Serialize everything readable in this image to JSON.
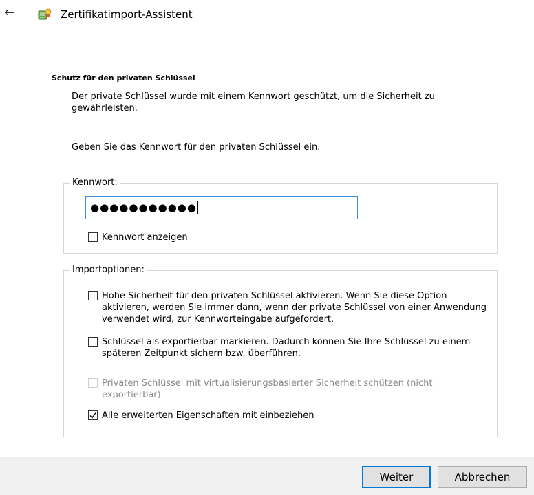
{
  "header": {
    "title": "Zertifikatimport-Assistent"
  },
  "section": {
    "title": "Schutz für den privaten Schlüssel",
    "description": "Der private Schlüssel wurde mit einem Kennwort geschützt, um die Sicherheit zu gewährleisten."
  },
  "instruction": "Geben Sie das Kennwort für den privaten Schlüssel ein.",
  "password_group": {
    "legend": "Kennwort:",
    "masked_value": "●●●●●●●●●●●",
    "show_password": {
      "label": "Kennwort anzeigen",
      "checked": false
    }
  },
  "import_options": {
    "legend": "Importoptionen:",
    "options": [
      {
        "label": "Hohe Sicherheit für den privaten Schlüssel aktivieren. Wenn Sie diese Option aktivieren, werden Sie immer dann, wenn der private Schlüssel von einer Anwendung verwendet wird, zur Kennworteingabe aufgefordert.",
        "checked": false,
        "enabled": true
      },
      {
        "label": "Schlüssel als exportierbar markieren. Dadurch können Sie Ihre Schlüssel zu einem späteren Zeitpunkt sichern bzw. überführen.",
        "checked": false,
        "enabled": true
      },
      {
        "label": "Privaten Schlüssel mit virtualisierungsbasierter Sicherheit schützen (nicht exportierbar)",
        "checked": false,
        "enabled": false
      },
      {
        "label": "Alle erweiterten Eigenschaften mit einbeziehen",
        "checked": true,
        "enabled": true
      }
    ]
  },
  "footer": {
    "next_label": "Weiter",
    "cancel_label": "Abbrechen"
  },
  "colors": {
    "accent": "#0078d7",
    "input_border": "#3c8bd9",
    "footer_bg": "#f0f0f0"
  }
}
